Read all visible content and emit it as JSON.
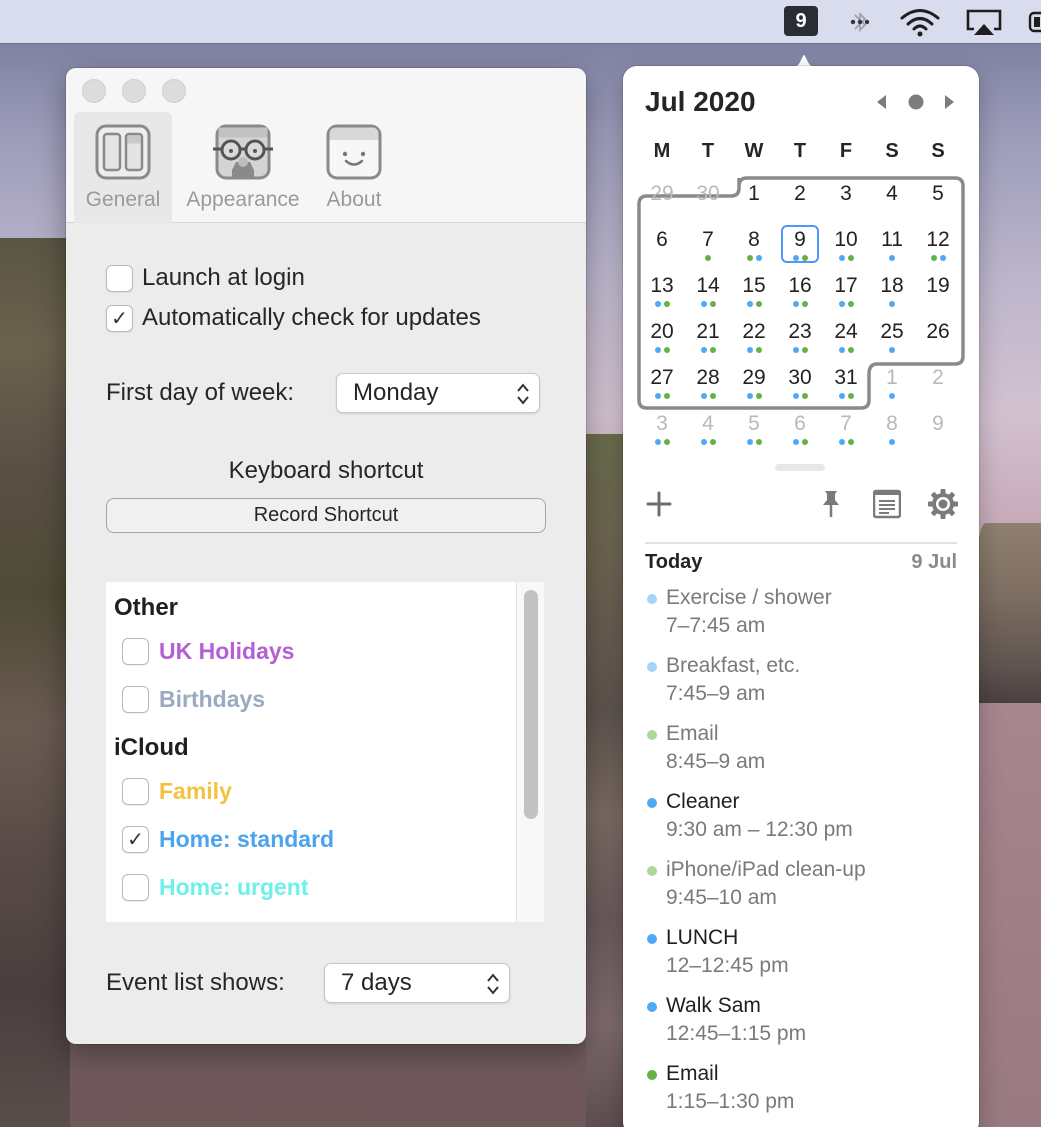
{
  "menubar": {
    "date_badge": "9",
    "icons": [
      "bluetooth-icon",
      "wifi-icon",
      "airplay-icon",
      "battery-icon"
    ]
  },
  "prefs": {
    "tabs": [
      {
        "label": "General",
        "icon": "general-panes-icon",
        "active": true
      },
      {
        "label": "Appearance",
        "icon": "appearance-glasses-face-icon",
        "active": false
      },
      {
        "label": "About",
        "icon": "about-smiley-icon",
        "active": false
      }
    ],
    "launch_at_login": {
      "label": "Launch at login",
      "checked": false
    },
    "auto_update": {
      "label": "Automatically check for updates",
      "checked": true
    },
    "first_day": {
      "label": "First day of week:",
      "value": "Monday"
    },
    "keyboard_shortcut": {
      "title": "Keyboard shortcut",
      "button": "Record Shortcut"
    },
    "calendar_groups": [
      {
        "title": "Other",
        "calendars": [
          {
            "name": "UK Holidays",
            "color": "#b55fd4",
            "checked": false
          },
          {
            "name": "Birthdays",
            "color": "#9aaac0",
            "checked": false
          }
        ]
      },
      {
        "title": "iCloud",
        "calendars": [
          {
            "name": "Family",
            "color": "#f5c141",
            "checked": false
          },
          {
            "name": "Home: standard",
            "color": "#4ca3ee",
            "checked": true
          },
          {
            "name": "Home: urgent",
            "color": "#6ef0ea",
            "checked": false
          }
        ]
      }
    ],
    "event_list": {
      "label": "Event list shows:",
      "value": "7 days"
    }
  },
  "calendar": {
    "month_title": "Jul 2020",
    "weekdays": [
      "M",
      "T",
      "W",
      "T",
      "F",
      "S",
      "S"
    ],
    "weeks": [
      [
        {
          "d": "29",
          "dim": true,
          "dots": []
        },
        {
          "d": "30",
          "dim": true,
          "dots": []
        },
        {
          "d": "1",
          "dots": []
        },
        {
          "d": "2",
          "dots": []
        },
        {
          "d": "3",
          "dots": []
        },
        {
          "d": "4",
          "dots": []
        },
        {
          "d": "5",
          "dots": []
        }
      ],
      [
        {
          "d": "6",
          "dots": []
        },
        {
          "d": "7",
          "dots": [
            "g"
          ]
        },
        {
          "d": "8",
          "dots": [
            "g",
            "b"
          ]
        },
        {
          "d": "9",
          "today": true,
          "dots": [
            "b",
            "g"
          ]
        },
        {
          "d": "10",
          "dots": [
            "b",
            "g"
          ]
        },
        {
          "d": "11",
          "dots": [
            "b"
          ]
        },
        {
          "d": "12",
          "dots": [
            "g",
            "b"
          ]
        }
      ],
      [
        {
          "d": "13",
          "dots": [
            "b",
            "g"
          ]
        },
        {
          "d": "14",
          "dots": [
            "b",
            "g"
          ]
        },
        {
          "d": "15",
          "dots": [
            "b",
            "g"
          ]
        },
        {
          "d": "16",
          "dots": [
            "b",
            "g"
          ]
        },
        {
          "d": "17",
          "dots": [
            "b",
            "g"
          ]
        },
        {
          "d": "18",
          "dots": [
            "b"
          ]
        },
        {
          "d": "19",
          "dots": []
        }
      ],
      [
        {
          "d": "20",
          "dots": [
            "b",
            "g"
          ]
        },
        {
          "d": "21",
          "dots": [
            "b",
            "g"
          ]
        },
        {
          "d": "22",
          "dots": [
            "b",
            "g"
          ]
        },
        {
          "d": "23",
          "dots": [
            "b",
            "g"
          ]
        },
        {
          "d": "24",
          "dots": [
            "b",
            "g"
          ]
        },
        {
          "d": "25",
          "dots": [
            "b"
          ]
        },
        {
          "d": "26",
          "dots": []
        }
      ],
      [
        {
          "d": "27",
          "dots": [
            "b",
            "g"
          ]
        },
        {
          "d": "28",
          "dots": [
            "b",
            "g"
          ]
        },
        {
          "d": "29",
          "dots": [
            "b",
            "g"
          ]
        },
        {
          "d": "30",
          "dots": [
            "b",
            "g"
          ]
        },
        {
          "d": "31",
          "dots": [
            "b",
            "g"
          ]
        },
        {
          "d": "1",
          "dim": true,
          "dots": [
            "b"
          ]
        },
        {
          "d": "2",
          "dim": true,
          "dots": []
        }
      ],
      [
        {
          "d": "3",
          "dim": true,
          "dots": [
            "b",
            "g"
          ]
        },
        {
          "d": "4",
          "dim": true,
          "dots": [
            "b",
            "g"
          ]
        },
        {
          "d": "5",
          "dim": true,
          "dots": [
            "b",
            "g"
          ]
        },
        {
          "d": "6",
          "dim": true,
          "dots": [
            "b",
            "g"
          ]
        },
        {
          "d": "7",
          "dim": true,
          "dots": [
            "b",
            "g"
          ]
        },
        {
          "d": "8",
          "dim": true,
          "dots": [
            "b"
          ]
        },
        {
          "d": "9",
          "dim": true,
          "dots": []
        }
      ]
    ],
    "dot_colors": {
      "b": "#4fa9f4",
      "g": "#66b145"
    },
    "today_ring_color": "#4b98f6",
    "toolbar": [
      "add-event-icon",
      "pin-icon",
      "event-list-icon",
      "settings-gear-icon"
    ],
    "agenda": {
      "heading": "Today",
      "date": "9 Jul",
      "events": [
        {
          "title": "Exercise / shower",
          "time": "7–7:45 am",
          "color": "#a6d3f8",
          "past": true
        },
        {
          "title": "Breakfast, etc.",
          "time": "7:45–9 am",
          "color": "#a6d3f8",
          "past": true
        },
        {
          "title": "Email",
          "time": "8:45–9 am",
          "color": "#aed79c",
          "past": true
        },
        {
          "title": "Cleaner",
          "time": "9:30 am – 12:30 pm",
          "color": "#4fa9f4",
          "past": false
        },
        {
          "title": "iPhone/iPad clean-up",
          "time": "9:45–10 am",
          "color": "#aed79c",
          "past": true
        },
        {
          "title": "LUNCH",
          "time": "12–12:45 pm",
          "color": "#4fa9f4",
          "past": false
        },
        {
          "title": "Walk Sam",
          "time": "12:45–1:15 pm",
          "color": "#4fa9f4",
          "past": false
        },
        {
          "title": "Email",
          "time": "1:15–1:30 pm",
          "color": "#66b145",
          "past": false
        }
      ]
    }
  }
}
